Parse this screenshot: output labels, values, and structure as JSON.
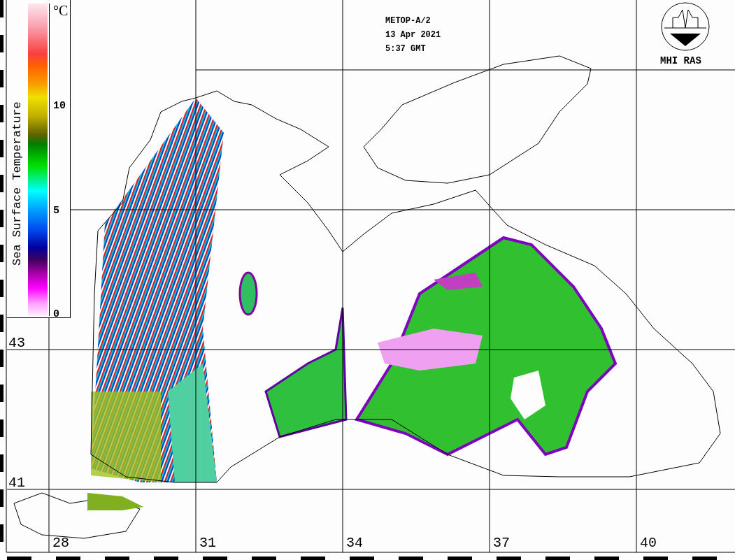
{
  "header": {
    "lines": [
      "METOP-A/2",
      "13 Apr 2021",
      "5:37 GMT"
    ]
  },
  "logo": {
    "caption": "MHI RAS"
  },
  "legend": {
    "title": "Sea Surface Temperature",
    "unit": "°C",
    "ticks": [
      "10",
      "5",
      "0"
    ]
  },
  "latitudes": [
    "43",
    "41"
  ],
  "longitudes": [
    "28",
    "31",
    "34",
    "37",
    "40"
  ]
}
